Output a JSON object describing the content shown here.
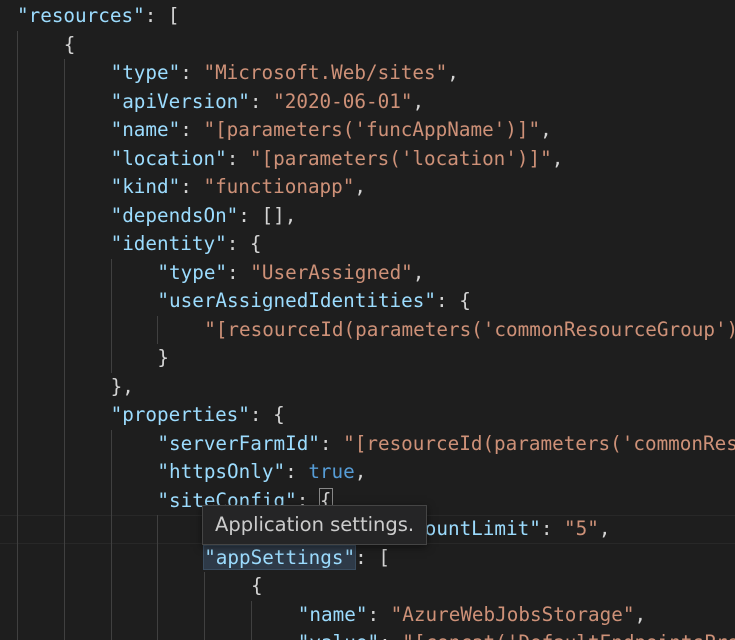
{
  "editor": {
    "theme_colors": {
      "background": "#1e1e1e",
      "key": "#9cdcfe",
      "string": "#ce9178",
      "keyword": "#569cd6",
      "punctuation": "#d4d4d4"
    },
    "lines": [
      {
        "indent": 0,
        "tokens": [
          {
            "t": "key",
            "v": "\"resources\""
          },
          {
            "t": "p",
            "v": ": ["
          }
        ]
      },
      {
        "indent": 1,
        "tokens": [
          {
            "t": "p",
            "v": "{"
          }
        ]
      },
      {
        "indent": 2,
        "tokens": [
          {
            "t": "key",
            "v": "\"type\""
          },
          {
            "t": "p",
            "v": ": "
          },
          {
            "t": "str",
            "v": "\"Microsoft.Web/sites\""
          },
          {
            "t": "p",
            "v": ","
          }
        ]
      },
      {
        "indent": 2,
        "tokens": [
          {
            "t": "key",
            "v": "\"apiVersion\""
          },
          {
            "t": "p",
            "v": ": "
          },
          {
            "t": "str",
            "v": "\"2020-06-01\""
          },
          {
            "t": "p",
            "v": ","
          }
        ]
      },
      {
        "indent": 2,
        "tokens": [
          {
            "t": "key",
            "v": "\"name\""
          },
          {
            "t": "p",
            "v": ": "
          },
          {
            "t": "str",
            "v": "\"[parameters('funcAppName')]\""
          },
          {
            "t": "p",
            "v": ","
          }
        ]
      },
      {
        "indent": 2,
        "tokens": [
          {
            "t": "key",
            "v": "\"location\""
          },
          {
            "t": "p",
            "v": ": "
          },
          {
            "t": "str",
            "v": "\"[parameters('location')]\""
          },
          {
            "t": "p",
            "v": ","
          }
        ]
      },
      {
        "indent": 2,
        "tokens": [
          {
            "t": "key",
            "v": "\"kind\""
          },
          {
            "t": "p",
            "v": ": "
          },
          {
            "t": "str",
            "v": "\"functionapp\""
          },
          {
            "t": "p",
            "v": ","
          }
        ]
      },
      {
        "indent": 2,
        "tokens": [
          {
            "t": "key",
            "v": "\"dependsOn\""
          },
          {
            "t": "p",
            "v": ": [],"
          }
        ]
      },
      {
        "indent": 2,
        "tokens": [
          {
            "t": "key",
            "v": "\"identity\""
          },
          {
            "t": "p",
            "v": ": {"
          }
        ]
      },
      {
        "indent": 3,
        "tokens": [
          {
            "t": "key",
            "v": "\"type\""
          },
          {
            "t": "p",
            "v": ": "
          },
          {
            "t": "str",
            "v": "\"UserAssigned\""
          },
          {
            "t": "p",
            "v": ","
          }
        ]
      },
      {
        "indent": 3,
        "tokens": [
          {
            "t": "key",
            "v": "\"userAssignedIdentities\""
          },
          {
            "t": "p",
            "v": ": {"
          }
        ]
      },
      {
        "indent": 4,
        "tokens": [
          {
            "t": "str",
            "v": "\"[resourceId(parameters('commonResourceGroup'),"
          }
        ]
      },
      {
        "indent": 3,
        "tokens": [
          {
            "t": "p",
            "v": "}"
          }
        ]
      },
      {
        "indent": 2,
        "tokens": [
          {
            "t": "p",
            "v": "},"
          }
        ]
      },
      {
        "indent": 2,
        "tokens": [
          {
            "t": "key",
            "v": "\"properties\""
          },
          {
            "t": "p",
            "v": ": {"
          }
        ]
      },
      {
        "indent": 3,
        "tokens": [
          {
            "t": "key",
            "v": "\"serverFarmId\""
          },
          {
            "t": "p",
            "v": ": "
          },
          {
            "t": "str",
            "v": "\"[resourceId(parameters('commonResourceGroup'),"
          }
        ]
      },
      {
        "indent": 3,
        "tokens": [
          {
            "t": "key",
            "v": "\"httpsOnly\""
          },
          {
            "t": "p",
            "v": ": "
          },
          {
            "t": "kw",
            "v": "true"
          },
          {
            "t": "p",
            "v": ","
          }
        ]
      },
      {
        "indent": 3,
        "tokens": [
          {
            "t": "key",
            "v": "\"siteConfig\""
          },
          {
            "t": "p",
            "v": ": "
          },
          {
            "t": "bm",
            "v": "{"
          }
        ]
      },
      {
        "indent": 4,
        "tokens": [
          {
            "t": "key",
            "v": "\"preWarmedInstanceCountLimit\""
          },
          {
            "t": "p",
            "v": ": "
          },
          {
            "t": "str",
            "v": "\"5\""
          },
          {
            "t": "p",
            "v": ","
          }
        ]
      },
      {
        "indent": 4,
        "tokens": [
          {
            "t": "keyhl",
            "v": "\"appSettings\""
          },
          {
            "t": "p",
            "v": ": ["
          }
        ]
      },
      {
        "indent": 5,
        "tokens": [
          {
            "t": "p",
            "v": "{"
          }
        ]
      },
      {
        "indent": 6,
        "tokens": [
          {
            "t": "key",
            "v": "\"name\""
          },
          {
            "t": "p",
            "v": ": "
          },
          {
            "t": "str",
            "v": "\"AzureWebJobsStorage\""
          },
          {
            "t": "p",
            "v": ","
          }
        ]
      },
      {
        "indent": 6,
        "tokens": [
          {
            "t": "key",
            "v": "\"value\""
          },
          {
            "t": "p",
            "v": ": "
          },
          {
            "t": "str",
            "v": "\"[concat('DefaultEndpointsProtocol=https"
          }
        ]
      }
    ]
  },
  "tooltip": {
    "text": "Application settings."
  }
}
